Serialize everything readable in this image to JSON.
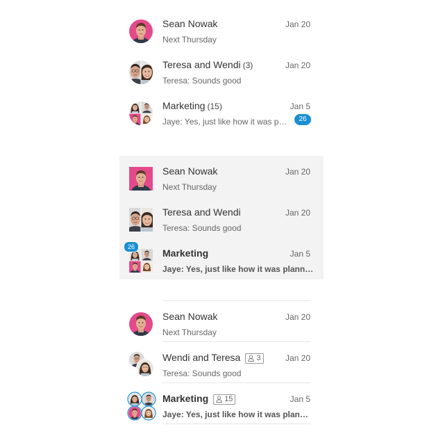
{
  "colors": {
    "accent": "#1b8fd2",
    "selected_bg": "#f3f3f3",
    "avatar_pink": "#e44a8a"
  },
  "variant1": {
    "items": [
      {
        "name": "Sean Nowak",
        "count": "",
        "date": "Jan 20",
        "snippet": "Next Thursday",
        "badge": ""
      },
      {
        "name": "Teresa and Wendi",
        "count": "(3)",
        "date": "Jan 20",
        "snippet": "Teresa: Sounds good",
        "badge": ""
      },
      {
        "name": "Marketing",
        "count": "(15)",
        "date": "Jan 5",
        "snippet": "Jaye: Yes, just like how it was planned",
        "badge": "26"
      }
    ]
  },
  "variant2": {
    "items": [
      {
        "name": "Sean Nowak",
        "date": "Jan 20",
        "snippet": "Next Thursday"
      },
      {
        "name": "Teresa and Wendi",
        "date": "Jan 20",
        "snippet": "Teresa: Sounds good"
      },
      {
        "name": "Marketing",
        "date": "Jan 5",
        "snippet": "Jaye: Yes, just like how it was planned",
        "badge": "26"
      }
    ]
  },
  "variant3": {
    "items": [
      {
        "name": "Sean Nowak",
        "date": "Jan 20",
        "snippet": "Next Thursday",
        "members": ""
      },
      {
        "name": "Wendi and Teresa",
        "date": "Jan 20",
        "snippet": "Teresa: Sounds good",
        "members": "3"
      },
      {
        "name": "Marketing",
        "date": "Jan 5",
        "snippet": "Jaye: Yes, just like how it was planned",
        "members": "15"
      }
    ]
  },
  "icons": {
    "avatar": "avatar-photo",
    "members": "people-icon"
  }
}
